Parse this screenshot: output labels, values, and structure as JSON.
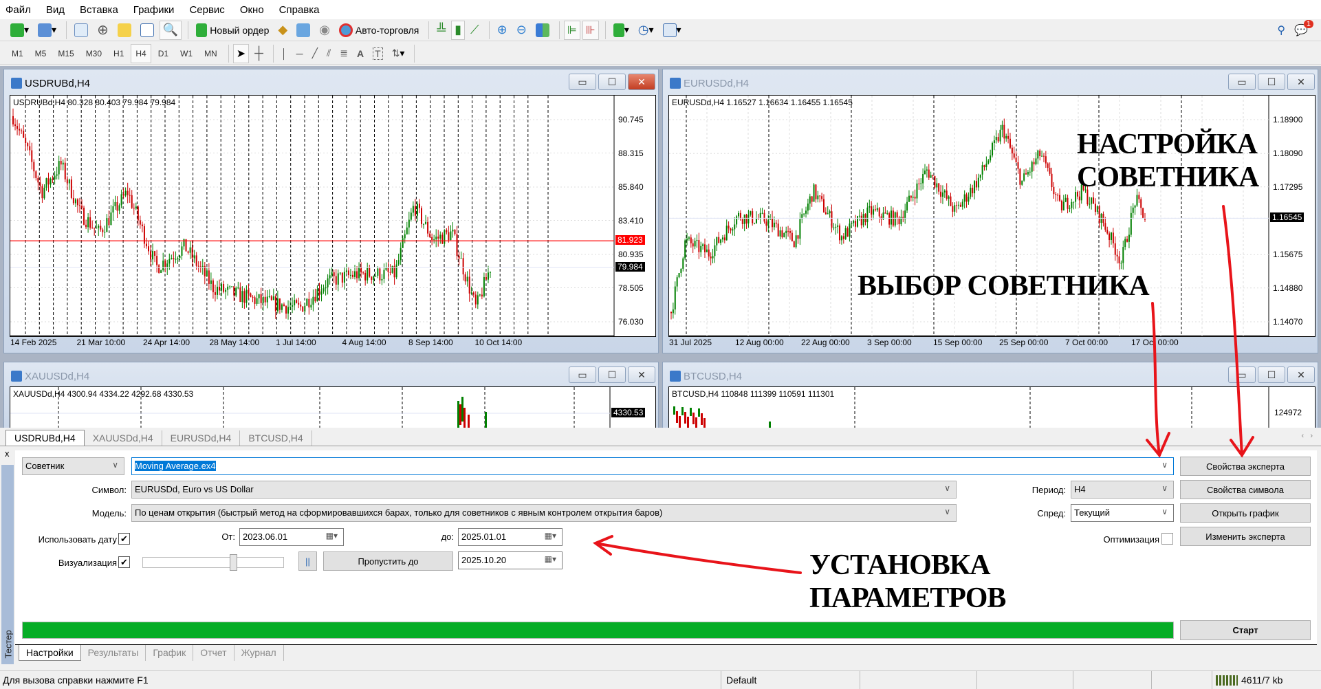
{
  "menu": [
    "Файл",
    "Вид",
    "Вставка",
    "Графики",
    "Сервис",
    "Окно",
    "Справка"
  ],
  "toolbar": {
    "new_order": "Новый ордер",
    "auto_trading": "Авто-торговля",
    "notification_count": "1"
  },
  "timeframes": [
    "M1",
    "M5",
    "M15",
    "M30",
    "H1",
    "H4",
    "D1",
    "W1",
    "MN"
  ],
  "active_timeframe": "H4",
  "colors": {
    "bull": "#008000",
    "bear": "#cc0000",
    "bid_line": "#ff0000",
    "progress": "#06ad26",
    "accent": "#0078d7"
  },
  "charts": {
    "usdrub": {
      "title": "USDRUBd,H4",
      "ohlc": "USDRUBd,H4  80.328 80.403 79.984 79.984",
      "prices": [
        "90.745",
        "88.315",
        "85.840",
        "83.410",
        "80.935",
        "78.505",
        "76.030"
      ],
      "dates": [
        "14 Feb 2025",
        "21 Mar 10:00",
        "24 Apr 14:00",
        "28 May 14:00",
        "1 Jul 14:00",
        "4 Aug 14:00",
        "8 Sep 14:00",
        "10 Oct 14:00"
      ],
      "line_price": "81.923",
      "current_price": "79.984"
    },
    "eurusd": {
      "title": "EURUSDd,H4",
      "ohlc": "EURUSDd,H4  1.16527 1.16634 1.16455 1.16545",
      "prices": [
        "1.18900",
        "1.18090",
        "1.17295",
        "1.16545",
        "1.15675",
        "1.14880",
        "1.14070"
      ],
      "dates": [
        "31 Jul 2025",
        "12 Aug 00:00",
        "22 Aug 00:00",
        "3 Sep 00:00",
        "15 Sep 00:00",
        "25 Sep 00:00",
        "7 Oct 00:00",
        "17 Oct 00:00"
      ],
      "current_price": "1.16545"
    },
    "xauusd": {
      "title": "XAUUSDd,H4",
      "ohlc": "XAUUSDd,H4  4300.94 4334.22 4292.68 4330.53",
      "current_price": "4330.53"
    },
    "btcusd": {
      "title": "BTCUSD,H4",
      "ohlc": "BTCUSD,H4  110848 111399 110591 111301",
      "price": "124972"
    }
  },
  "chart_tabs": [
    "USDRUBd,H4",
    "XAUUSDd,H4",
    "EURUSDd,H4",
    "BTCUSD,H4"
  ],
  "tester": {
    "side_label": "Тестер",
    "close": "x",
    "type_select": "Советник",
    "expert": "Moving Average.ex4",
    "symbol_label": "Символ:",
    "symbol": "EURUSDd, Euro vs US Dollar",
    "model_label": "Модель:",
    "model": "По ценам открытия (быстрый метод на сформировавшихся барах, только для советников с явным контролем открытия баров)",
    "period_label": "Период:",
    "period": "H4",
    "spread_label": "Спред:",
    "spread": "Текущий",
    "use_date_label": "Использовать дату",
    "use_date_checked": true,
    "from_label": "От:",
    "from": "2023.06.01",
    "to_label": "до:",
    "to": "2025.01.01",
    "optimization_label": "Оптимизация",
    "optimization_checked": false,
    "visual_label": "Визуализация",
    "visual_checked": true,
    "speed_percent": 65,
    "pause": "||",
    "skip_to_label": "Пропустить до",
    "skip_to": "2025.10.20",
    "progress_percent": 100,
    "buttons": [
      "Свойства эксперта",
      "Свойства символа",
      "Открыть график",
      "Изменить эксперта"
    ],
    "start": "Старт",
    "tabs": [
      "Настройки",
      "Результаты",
      "График",
      "Отчет",
      "Журнал"
    ]
  },
  "status": {
    "help": "Для вызова справки нажмите F1",
    "profile": "Default",
    "traffic": "4611/7 kb"
  },
  "annotations": {
    "expert_setup": [
      "НАСТРОЙКА",
      "СОВЕТНИКА"
    ],
    "expert_choice": "ВЫБОР СОВЕТНИКА",
    "params": [
      "УСТАНОВКА",
      "ПАРАМЕТРОВ"
    ]
  }
}
